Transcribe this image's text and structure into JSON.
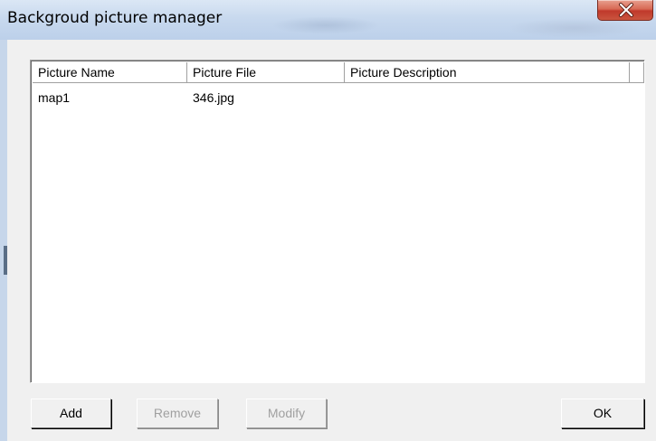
{
  "window": {
    "title": "Backgroud picture manager"
  },
  "list": {
    "columns": [
      "Picture Name",
      "Picture File",
      "Picture Description"
    ],
    "rows": [
      {
        "name": "map1",
        "file": "346.jpg",
        "description": ""
      }
    ]
  },
  "buttons": {
    "add": "Add",
    "remove": "Remove",
    "modify": "Modify",
    "ok": "OK"
  },
  "icons": {
    "close": "close-icon"
  }
}
